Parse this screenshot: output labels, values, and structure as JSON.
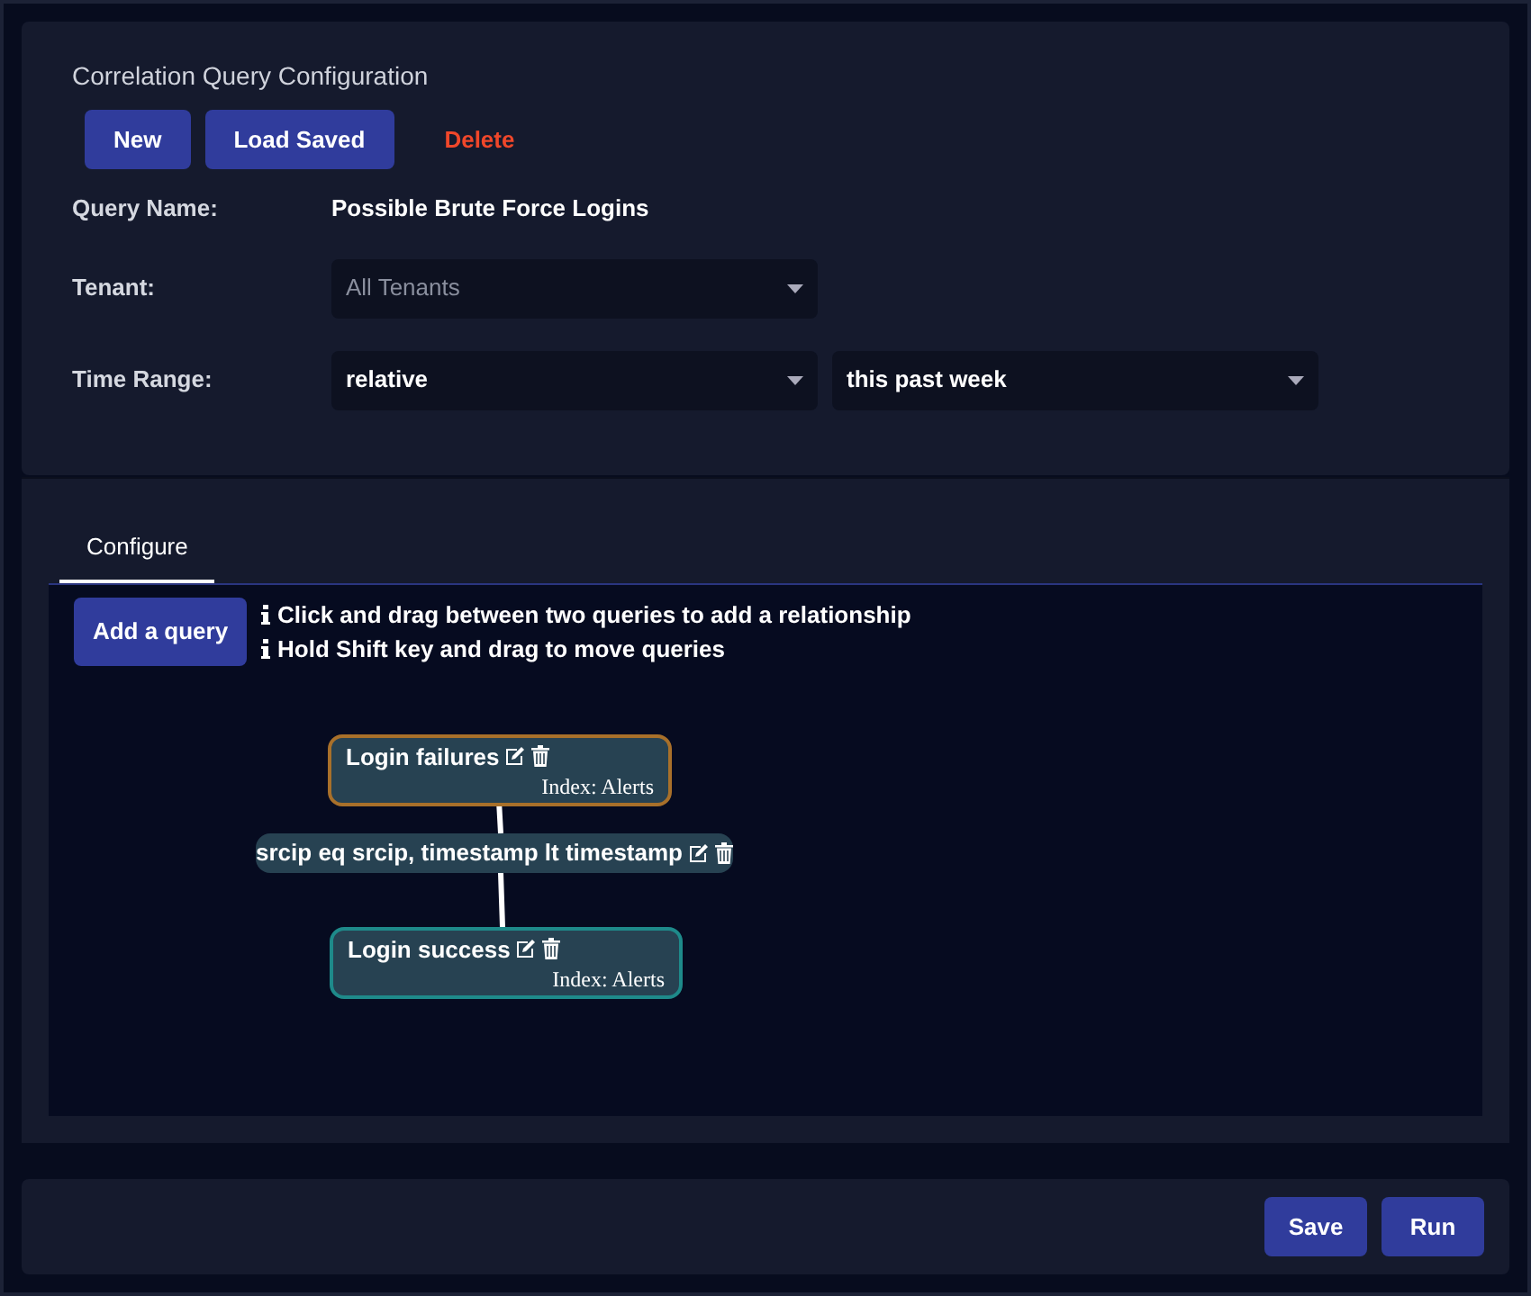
{
  "config": {
    "title": "Correlation Query Configuration",
    "buttons": [
      {
        "label": "New",
        "kind": "primary"
      },
      {
        "label": "Load Saved",
        "kind": "primary"
      },
      {
        "label": "Delete",
        "kind": "danger"
      }
    ],
    "fields": [
      {
        "label": "Query Name:",
        "kind": "text",
        "value": "Possible Brute Force Logins"
      },
      {
        "label": "Tenant:",
        "kind": "select",
        "selects": [
          {
            "value": "All Tenants",
            "disabled": true
          }
        ]
      },
      {
        "label": "Time Range:",
        "kind": "select",
        "selects": [
          {
            "value": "relative",
            "disabled": false
          },
          {
            "value": "this past week",
            "disabled": false
          }
        ]
      }
    ]
  },
  "tabs": [
    {
      "label": "Configure",
      "selected": true
    }
  ],
  "canvas": {
    "add_button": "Add a query",
    "hints": [
      "Click and drag between two queries to add a relationship",
      "Hold Shift key and drag to move queries"
    ],
    "nodes": [
      {
        "kind": "query",
        "name": "Login failures",
        "index": "Index: Alerts",
        "color": "#a8702a"
      },
      {
        "kind": "relation",
        "name": "srcip eq srcip, timestamp lt timestamp"
      },
      {
        "kind": "query",
        "name": "Login success",
        "index": "Index: Alerts",
        "color": "#1e8a8a"
      }
    ]
  },
  "footer": {
    "buttons": [
      "Save",
      "Run"
    ]
  }
}
